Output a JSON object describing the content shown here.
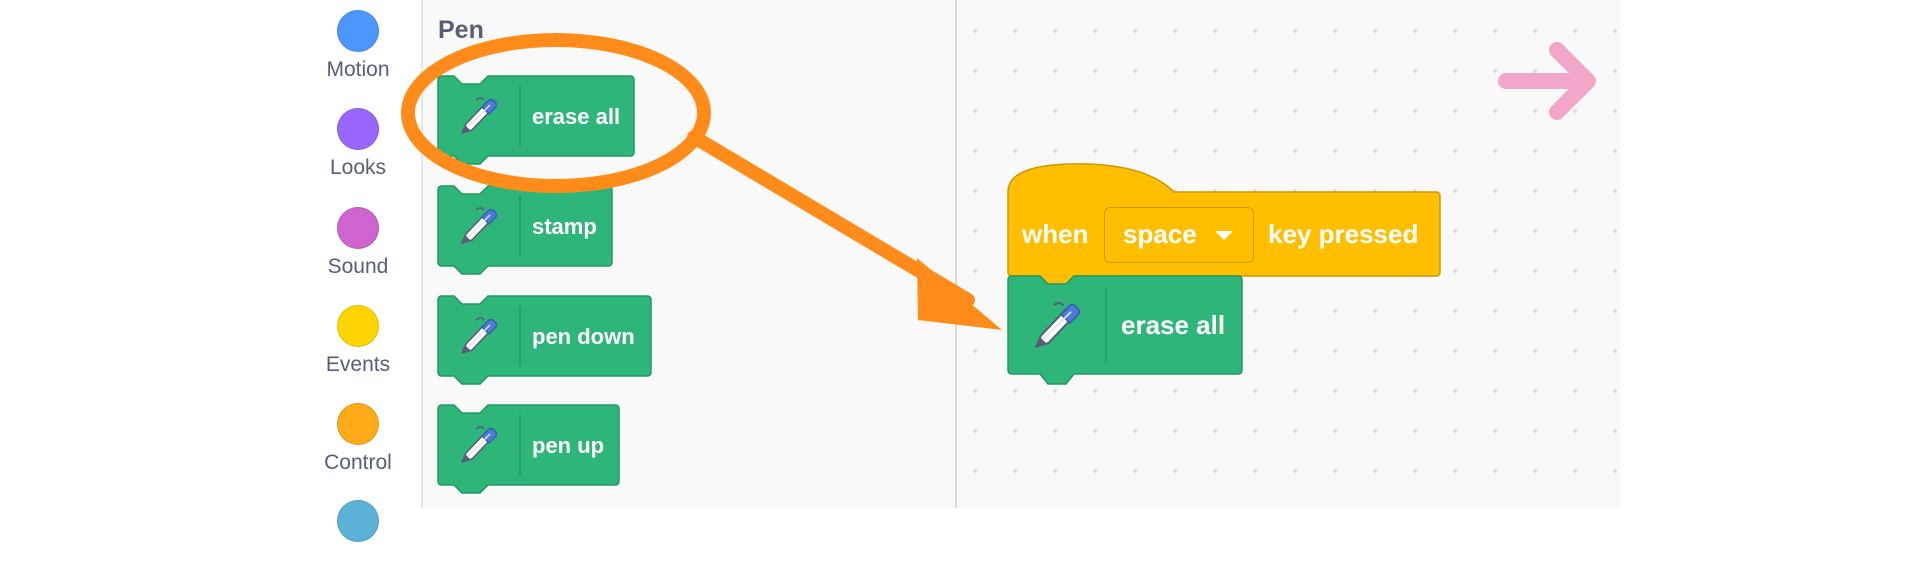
{
  "categories": [
    {
      "label": "Motion",
      "color": "#4c97ff"
    },
    {
      "label": "Looks",
      "color": "#9966ff"
    },
    {
      "label": "Sound",
      "color": "#cf63cf"
    },
    {
      "label": "Events",
      "color": "#ffd500"
    },
    {
      "label": "Control",
      "color": "#ffab19"
    },
    {
      "label": "",
      "color": "#5cb1d6"
    }
  ],
  "palette": {
    "heading": "Pen",
    "blocks": [
      {
        "label": "erase all",
        "icon": "pen-icon"
      },
      {
        "label": "stamp",
        "icon": "pen-icon"
      },
      {
        "label": "pen down",
        "icon": "pen-icon"
      },
      {
        "label": "pen up",
        "icon": "pen-icon"
      }
    ],
    "block_color": "#2eb57a"
  },
  "workspace": {
    "hat_block": {
      "when": "when",
      "key": "space",
      "suffix": "key pressed",
      "color": "#ffbf00"
    },
    "stack_block": {
      "label": "erase all",
      "icon": "pen-icon"
    }
  },
  "annotations": {
    "highlight_color": "#ff8c1a",
    "go_arrow_color": "#f2a6c8"
  }
}
